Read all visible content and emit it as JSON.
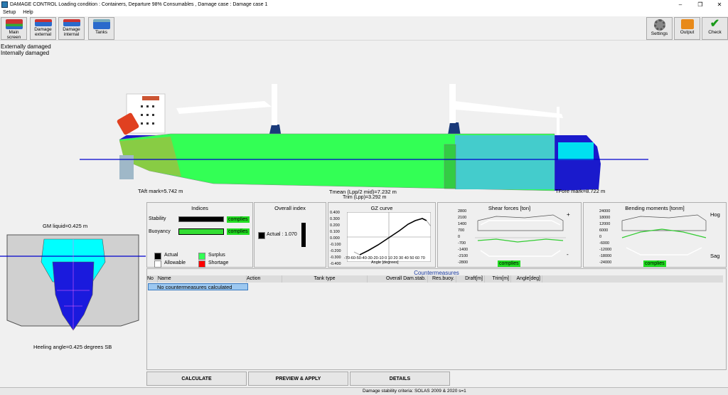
{
  "titlebar": {
    "title": "DAMAGE CONTROL  Loading condition : Containers, Departure 98% Consumables , Damage case : Damage case 1"
  },
  "menu": {
    "setup": "Setup",
    "help": "Help"
  },
  "toolbar": {
    "main_screen": "Main screen",
    "damage_external_1": "Damage",
    "damage_external_2": "external",
    "damage_internal_1": "Damage",
    "damage_internal_2": "internal",
    "tanks": "Tanks",
    "settings": "Settings",
    "output": "Output",
    "check": "Check"
  },
  "damage_status": {
    "external": "Externally damaged",
    "internal": "Internally damaged"
  },
  "ship_view": {
    "taft_mark": "TAft mark=5.742 m",
    "tfore_mark": "TFore mark=8.722 m",
    "tmean": "Tmean (Lpp/2 mid)=7.232 m",
    "trim": "Trim (Lpp)=3.292 m"
  },
  "section_view": {
    "gm_liquid": "GM liquid=0.425 m",
    "heeling_angle": "Heeling angle=0.425 degrees SB"
  },
  "indices": {
    "title": "Indices",
    "stability_label": "Stability",
    "stability_status": "complies",
    "buoyancy_label": "Buoyancy",
    "buoyancy_status": "complies",
    "legend": {
      "actual": "Actual",
      "surplus": "Surplus",
      "allowable": "Allowable",
      "shortage": "Shortage"
    }
  },
  "overall_index": {
    "title": "Overall index",
    "actual_label": "Actual : 1.070"
  },
  "gz_curve": {
    "title": "GZ curve",
    "xlabel": "Angle [degrees]",
    "yticks": [
      "0.400",
      "0.300",
      "0.200",
      "0.100",
      "0.000",
      "-0.100",
      "-0.200",
      "-0.300",
      "-0.400"
    ],
    "xticks": "-70-60-50-40-30-20-10 0 10 20 30 40 50 60 70"
  },
  "shear_forces": {
    "title": "Shear forces [ton]",
    "yticks": [
      "2800",
      "2100",
      "1400",
      "700",
      "0",
      "-700",
      "-1400",
      "-2100",
      "-2800"
    ],
    "plus": "+",
    "minus": "-",
    "status": "complies"
  },
  "bending_moments": {
    "title": "Bending moments [tonm]",
    "yticks": [
      "24000",
      "18000",
      "12000",
      "6000",
      "0",
      "-6000",
      "-12000",
      "-18000",
      "-24000"
    ],
    "hog": "Hog",
    "sag": "Sag",
    "status": "complies"
  },
  "countermeasures": {
    "title": "Countermeasures",
    "columns": [
      "No",
      "Name",
      "Action",
      "Tank type",
      "Overall Dam.stab.",
      "Res.buoy.",
      "Draft[m]",
      "Trim[m]",
      "Angle[deg]"
    ],
    "empty_message": "No countermeasures calculated"
  },
  "buttons": {
    "calculate": "CALCULATE",
    "preview_apply": "PREVIEW & APPLY",
    "details": "DETAILS"
  },
  "status_bar": {
    "criteria": "Damage stability criteria: SOLAS 2009 & 2020 s=1"
  },
  "colors": {
    "intact_compartment": "#33ff55",
    "damaged_compartment": "#44cccc",
    "flooded": "#1a1acc",
    "waterline": "#0000cc",
    "complies": "#22dd22"
  }
}
